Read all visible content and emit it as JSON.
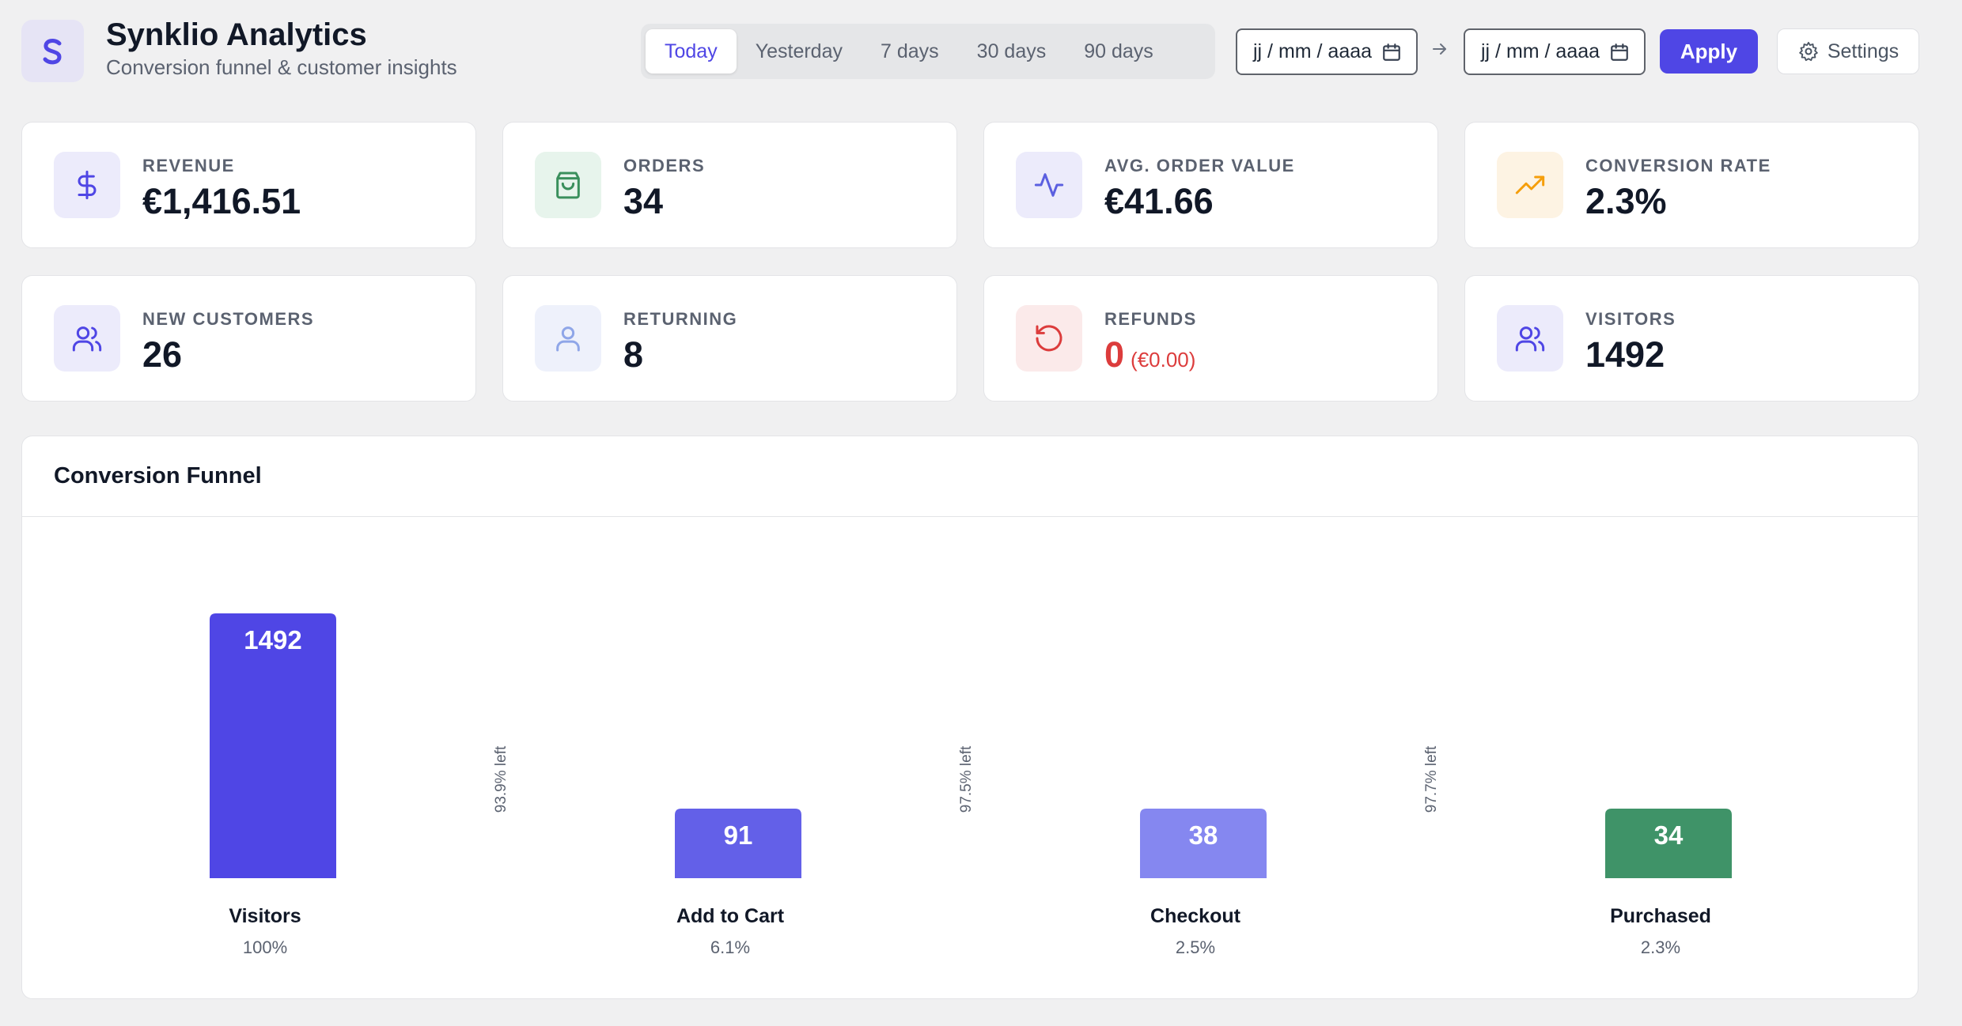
{
  "app": {
    "title": "Synklio Analytics",
    "subtitle": "Conversion funnel & customer insights",
    "logo_letter": "S",
    "accent": "#4f46e5"
  },
  "range_tabs": [
    {
      "label": "Today",
      "active": true
    },
    {
      "label": "Yesterday",
      "active": false
    },
    {
      "label": "7 days",
      "active": false
    },
    {
      "label": "30 days",
      "active": false
    },
    {
      "label": "90 days",
      "active": false
    }
  ],
  "date_range": {
    "start_placeholder": "jj / mm / aaaa",
    "end_placeholder": "jj / mm / aaaa",
    "apply_label": "Apply",
    "settings_label": "Settings"
  },
  "stats": [
    {
      "label": "REVENUE",
      "value": "€1,416.51",
      "icon": "dollar-icon",
      "color": "#4f46e5"
    },
    {
      "label": "ORDERS",
      "value": "34",
      "icon": "shopping-bag-icon",
      "color": "#3a8f5c"
    },
    {
      "label": "AVG. ORDER VALUE",
      "value": "€41.66",
      "icon": "activity-icon",
      "color": "#5b5fe0"
    },
    {
      "label": "CONVERSION RATE",
      "value": "2.3%",
      "icon": "trending-up-icon",
      "color": "#f59e0b"
    },
    {
      "label": "NEW CUSTOMERS",
      "value": "26",
      "icon": "users-icon",
      "color": "#4f46e5"
    },
    {
      "label": "RETURNING",
      "value": "8",
      "icon": "user-icon",
      "color": "#8fa6e8"
    },
    {
      "label": "REFUNDS",
      "value": "0",
      "sub": "(€0.00)",
      "icon": "refresh-icon",
      "color": "#dc3c3c"
    },
    {
      "label": "VISITORS",
      "value": "1492",
      "icon": "users-icon",
      "color": "#4f46e5"
    }
  ],
  "funnel": {
    "title": "Conversion Funnel"
  },
  "chart_data": {
    "type": "bar",
    "categories": [
      "Visitors",
      "Add to Cart",
      "Checkout",
      "Purchased"
    ],
    "values": [
      1492,
      91,
      38,
      34
    ],
    "percentages": [
      "100%",
      "6.1%",
      "2.5%",
      "2.3%"
    ],
    "drop_labels": [
      "93.9% left",
      "97.5% left",
      "97.7% left"
    ],
    "colors": [
      "#4f46e5",
      "#6360e8",
      "#8587f0",
      "#3f9368"
    ],
    "grid": false
  }
}
